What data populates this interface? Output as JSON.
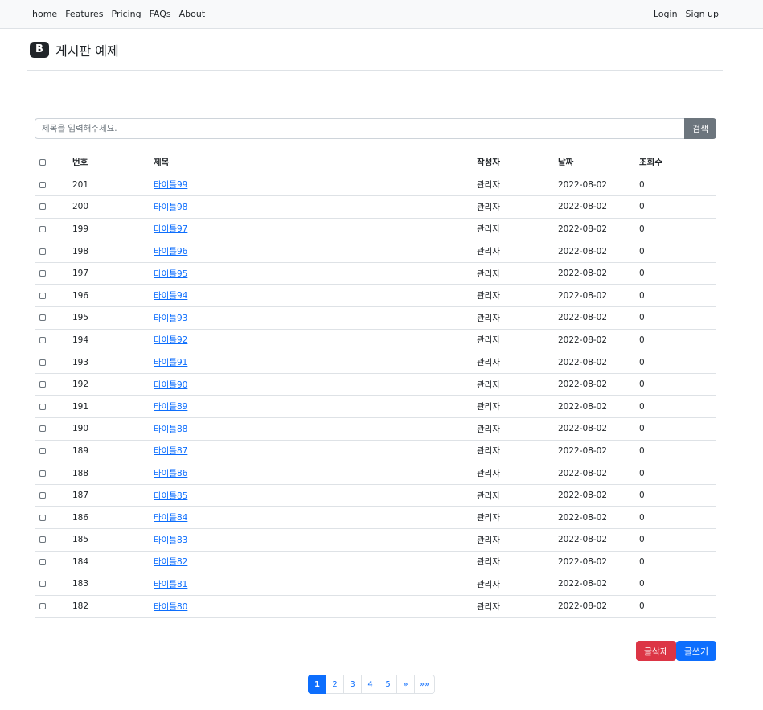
{
  "nav": {
    "left": [
      "home",
      "Features",
      "Pricing",
      "FAQs",
      "About"
    ],
    "login": "Login",
    "signup": "Sign up"
  },
  "brand": {
    "logo": "B",
    "title": "게시판 예제"
  },
  "search": {
    "placeholder": "제목을 입력해주세요.",
    "button": "검색"
  },
  "table": {
    "headers": {
      "no": "번호",
      "title": "제목",
      "author": "작성자",
      "date": "날짜",
      "views": "조회수"
    },
    "rows": [
      {
        "no": "201",
        "title": "타이틀99",
        "author": "관리자",
        "date": "2022-08-02",
        "views": "0"
      },
      {
        "no": "200",
        "title": "타이틀98",
        "author": "관리자",
        "date": "2022-08-02",
        "views": "0"
      },
      {
        "no": "199",
        "title": "타이틀97",
        "author": "관리자",
        "date": "2022-08-02",
        "views": "0"
      },
      {
        "no": "198",
        "title": "타이틀96",
        "author": "관리자",
        "date": "2022-08-02",
        "views": "0"
      },
      {
        "no": "197",
        "title": "타이틀95",
        "author": "관리자",
        "date": "2022-08-02",
        "views": "0"
      },
      {
        "no": "196",
        "title": "타이틀94",
        "author": "관리자",
        "date": "2022-08-02",
        "views": "0"
      },
      {
        "no": "195",
        "title": "타이틀93",
        "author": "관리자",
        "date": "2022-08-02",
        "views": "0"
      },
      {
        "no": "194",
        "title": "타이틀92",
        "author": "관리자",
        "date": "2022-08-02",
        "views": "0"
      },
      {
        "no": "193",
        "title": "타이틀91",
        "author": "관리자",
        "date": "2022-08-02",
        "views": "0"
      },
      {
        "no": "192",
        "title": "타이틀90",
        "author": "관리자",
        "date": "2022-08-02",
        "views": "0"
      },
      {
        "no": "191",
        "title": "타이틀89",
        "author": "관리자",
        "date": "2022-08-02",
        "views": "0"
      },
      {
        "no": "190",
        "title": "타이틀88",
        "author": "관리자",
        "date": "2022-08-02",
        "views": "0"
      },
      {
        "no": "189",
        "title": "타이틀87",
        "author": "관리자",
        "date": "2022-08-02",
        "views": "0"
      },
      {
        "no": "188",
        "title": "타이틀86",
        "author": "관리자",
        "date": "2022-08-02",
        "views": "0"
      },
      {
        "no": "187",
        "title": "타이틀85",
        "author": "관리자",
        "date": "2022-08-02",
        "views": "0"
      },
      {
        "no": "186",
        "title": "타이틀84",
        "author": "관리자",
        "date": "2022-08-02",
        "views": "0"
      },
      {
        "no": "185",
        "title": "타이틀83",
        "author": "관리자",
        "date": "2022-08-02",
        "views": "0"
      },
      {
        "no": "184",
        "title": "타이틀82",
        "author": "관리자",
        "date": "2022-08-02",
        "views": "0"
      },
      {
        "no": "183",
        "title": "타이틀81",
        "author": "관리자",
        "date": "2022-08-02",
        "views": "0"
      },
      {
        "no": "182",
        "title": "타이틀80",
        "author": "관리자",
        "date": "2022-08-02",
        "views": "0"
      }
    ]
  },
  "actions": {
    "delete": "글삭제",
    "write": "글쓰기"
  },
  "pagination": {
    "pages": [
      "1",
      "2",
      "3",
      "4",
      "5",
      "»",
      "»»"
    ],
    "current": "1"
  },
  "colors": {
    "primary": "#0d6efd",
    "danger": "#dc3545",
    "secondary": "#6c757d"
  }
}
